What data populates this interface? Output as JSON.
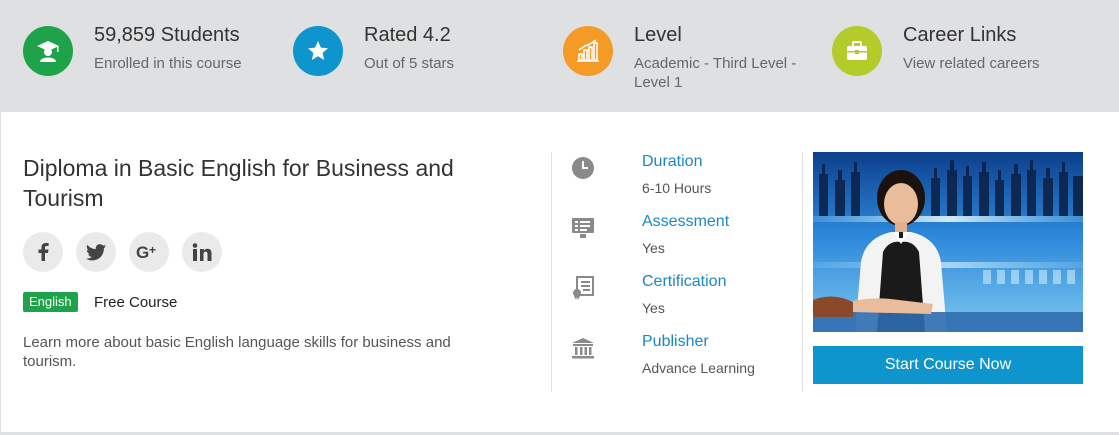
{
  "stats": [
    {
      "title": "59,859 Students",
      "sub": "Enrolled in this course",
      "icon": "graduate-icon",
      "color": "#1fa34a"
    },
    {
      "title": "Rated 4.2",
      "sub": "Out of 5 stars",
      "icon": "star-icon",
      "color": "#0f95cd"
    },
    {
      "title": "Level",
      "sub": "Academic - Third Level - Level 1",
      "icon": "bar-chart-icon",
      "color": "#f39a27"
    },
    {
      "title": "Career Links",
      "sub": "View related careers",
      "icon": "briefcase-icon",
      "color": "#b3cc29"
    }
  ],
  "course": {
    "title": "Diploma in Basic English for Business and Tourism",
    "language": "English",
    "price": "Free Course",
    "description": "Learn more about basic English language skills for business and tourism."
  },
  "socials": [
    "f",
    "twitter-icon",
    "G+",
    "in"
  ],
  "details": [
    {
      "label": "Duration",
      "value": "6-10 Hours",
      "icon": "clock-icon"
    },
    {
      "label": "Assessment",
      "value": "Yes",
      "icon": "checklist-icon"
    },
    {
      "label": "Certification",
      "value": "Yes",
      "icon": "certificate-icon"
    },
    {
      "label": "Publisher",
      "value": "Advance Learning",
      "icon": "institution-icon"
    }
  ],
  "cta": {
    "label": "Start Course Now"
  },
  "colors": {
    "link": "#1b87c5",
    "button": "#0f95cd",
    "band": "#dfe0e2"
  }
}
